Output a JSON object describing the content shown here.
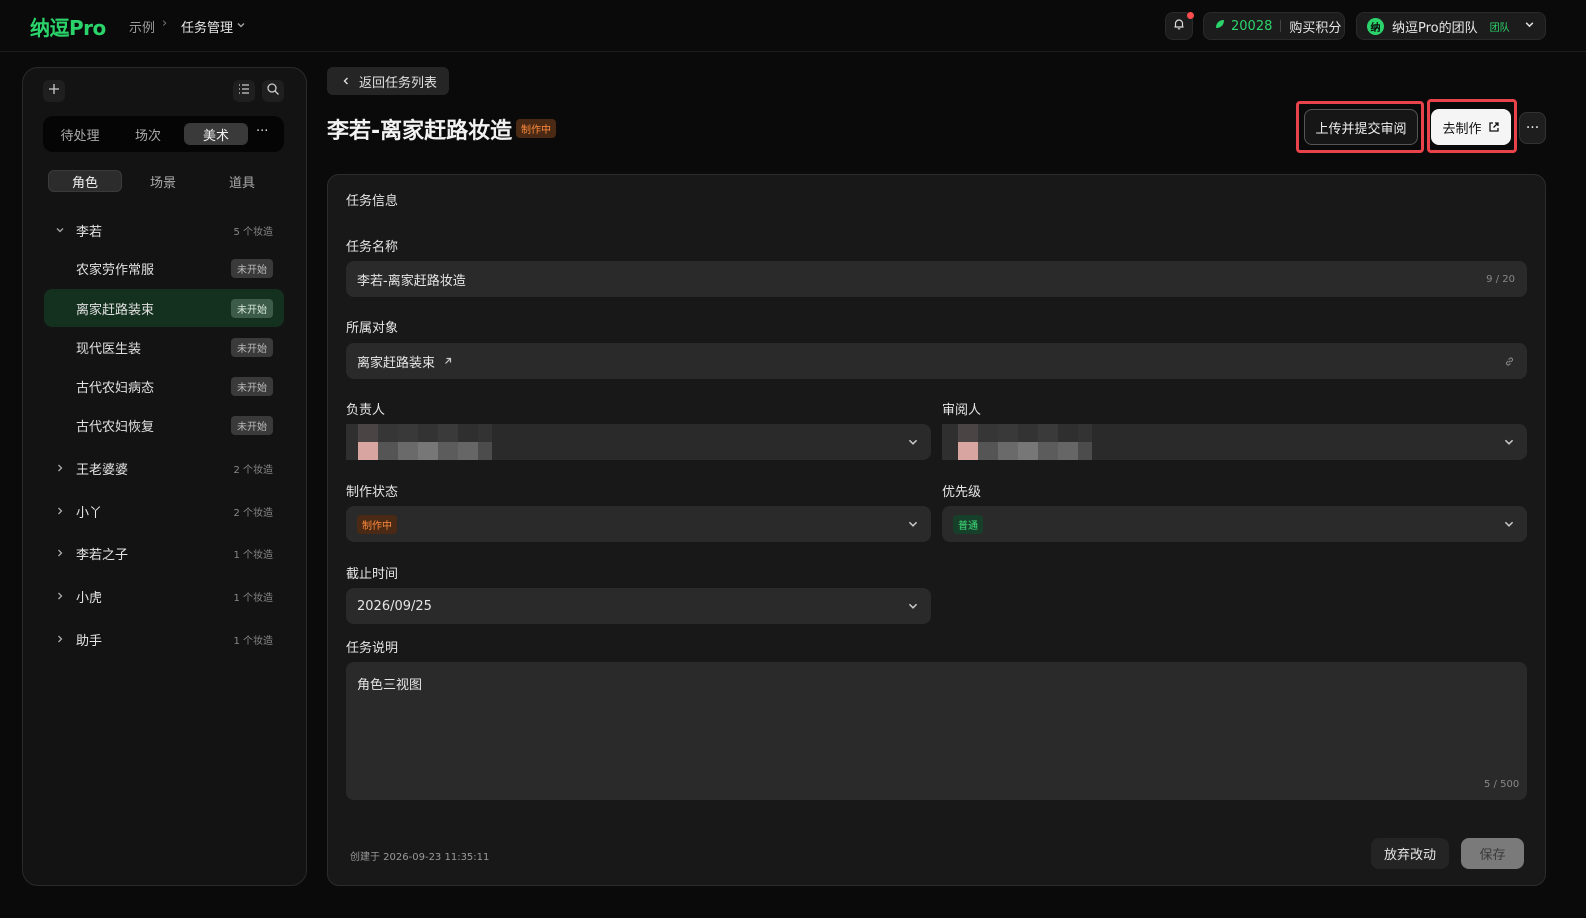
{
  "header": {
    "logo": "纳逗Pro",
    "breadcrumb": [
      "示例",
      "任务管理"
    ],
    "points": "20028",
    "buy_points": "购买积分",
    "team_avatar": "纳",
    "team_name": "纳逗Pro的团队",
    "team_badge": "团队"
  },
  "sidebar": {
    "tabs": [
      "待处理",
      "场次",
      "美术"
    ],
    "more": "···",
    "sub_tabs": [
      "角色",
      "场景",
      "道具"
    ],
    "groups": [
      {
        "name": "李若",
        "count": "5 个妆造"
      },
      {
        "name": "王老婆婆",
        "count": "2 个妆造"
      },
      {
        "name": "小丫",
        "count": "2 个妆造"
      },
      {
        "name": "李若之子",
        "count": "1 个妆造"
      },
      {
        "name": "小虎",
        "count": "1 个妆造"
      },
      {
        "name": "助手",
        "count": "1 个妆造"
      }
    ],
    "children": [
      {
        "name": "农家劳作常服",
        "status": "未开始"
      },
      {
        "name": "离家赶路装束",
        "status": "未开始"
      },
      {
        "name": "现代医生装",
        "status": "未开始"
      },
      {
        "name": "古代农妇病态",
        "status": "未开始"
      },
      {
        "name": "古代农妇恢复",
        "status": "未开始"
      }
    ]
  },
  "main": {
    "back_label": "返回任务列表",
    "title": "李若-离家赶路妆造",
    "title_status": "制作中",
    "submit_btn": "上传并提交审阅",
    "goto_btn": "去制作",
    "more": "···",
    "section_title": "任务信息",
    "task_name_label": "任务名称",
    "task_name_value": "李若-离家赶路妆造",
    "task_name_count": "9 / 20",
    "object_label": "所属对象",
    "object_value": "离家赶路装束",
    "owner_label": "负责人",
    "reviewer_label": "审阅人",
    "status_label": "制作状态",
    "status_value": "制作中",
    "priority_label": "优先级",
    "priority_value": "普通",
    "deadline_label": "截止时间",
    "deadline_value": "2026/09/25",
    "desc_label": "任务说明",
    "desc_value": "角色三视图",
    "desc_count": "5 / 500",
    "created": "创建于 2026-09-23 11:35:11",
    "discard_btn": "放弃改动",
    "save_btn": "保存"
  },
  "colors": {
    "accent": "#2bd46a",
    "highlight": "#e8424a",
    "status_making": "#ff8a3d"
  }
}
